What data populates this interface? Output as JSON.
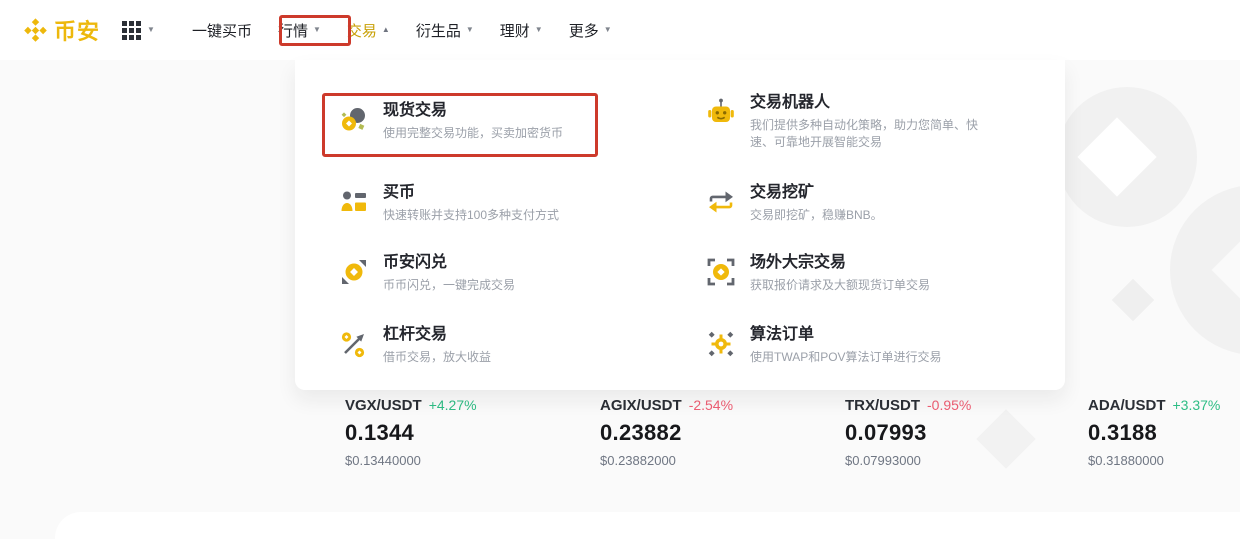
{
  "brand": {
    "name": "币安"
  },
  "nav": {
    "items": [
      {
        "key": "buy-crypto-express",
        "label": "一键买币",
        "caret": ""
      },
      {
        "key": "markets",
        "label": "行情",
        "caret": "down"
      },
      {
        "key": "trade",
        "label": "交易",
        "caret": "up",
        "active": true
      },
      {
        "key": "derivatives",
        "label": "衍生品",
        "caret": "down"
      },
      {
        "key": "earn",
        "label": "理财",
        "caret": "down"
      },
      {
        "key": "more",
        "label": "更多",
        "caret": "down"
      }
    ]
  },
  "menu": {
    "left": [
      {
        "key": "spot-trading",
        "icon": "spot-trading-icon",
        "title": "现货交易",
        "desc": "使用完整交易功能，买卖加密货币",
        "highlighted": true
      },
      {
        "key": "buy-crypto",
        "icon": "buy-crypto-icon",
        "title": "买币",
        "desc": "快速转账并支持100多种支付方式"
      },
      {
        "key": "convert",
        "icon": "convert-icon",
        "title": "币安闪兑",
        "desc": "币币闪兑，一键完成交易"
      },
      {
        "key": "margin",
        "icon": "margin-icon",
        "title": "杠杆交易",
        "desc": "借币交易，放大收益"
      }
    ],
    "right": [
      {
        "key": "trading-bots",
        "icon": "trading-bot-icon",
        "title": "交易机器人",
        "desc": "我们提供多种自动化策略，助力您简单、快速、可靠地开展智能交易"
      },
      {
        "key": "trade-mining",
        "icon": "trade-mining-icon",
        "title": "交易挖矿",
        "desc": "交易即挖矿，稳赚BNB。"
      },
      {
        "key": "otc-block-trading",
        "icon": "otc-icon",
        "title": "场外大宗交易",
        "desc": "获取报价请求及大额现货订单交易"
      },
      {
        "key": "algo-orders",
        "icon": "algo-order-icon",
        "title": "算法订单",
        "desc": "使用TWAP和POV算法订单进行交易"
      }
    ]
  },
  "tickers": [
    {
      "pair": "VGX/USDT",
      "change": "+4.27%",
      "direction": "up",
      "price": "0.1344",
      "usd": "$0.13440000"
    },
    {
      "pair": "AGIX/USDT",
      "change": "-2.54%",
      "direction": "down",
      "price": "0.23882",
      "usd": "$0.23882000"
    },
    {
      "pair": "TRX/USDT",
      "change": "-0.95%",
      "direction": "down",
      "price": "0.07993",
      "usd": "$0.07993000"
    },
    {
      "pair": "ADA/USDT",
      "change": "+3.37%",
      "direction": "up",
      "price": "0.3188",
      "usd": "$0.31880000"
    }
  ],
  "colors": {
    "accent": "#f0b90b",
    "up": "#2ebd85",
    "down": "#ef5e73",
    "highlight_red": "#cd3a2b"
  }
}
